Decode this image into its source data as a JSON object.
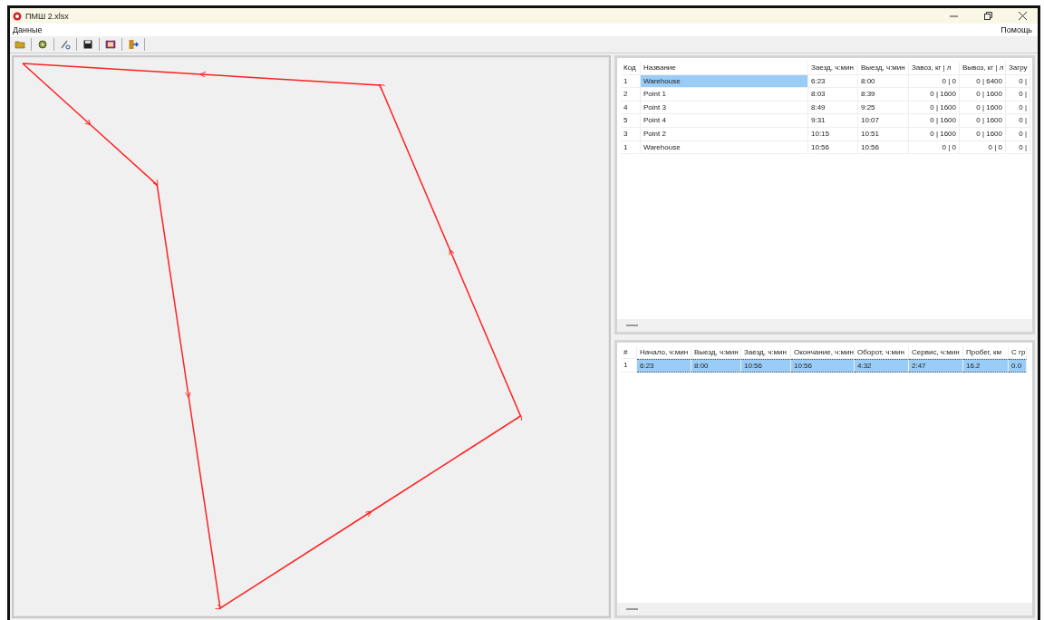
{
  "window": {
    "title": "ПМШ 2.xlsx"
  },
  "menu": {
    "left": "Данные",
    "right": "Помощь"
  },
  "stops_table": {
    "columns": [
      "Код",
      "Название",
      "Заезд, ч:мин",
      "Выезд, ч:мин",
      "Завоз, кг | л",
      "Вывоз, кг | л",
      "Загру"
    ],
    "rows": [
      {
        "selected": true,
        "cells": [
          "1",
          "Warehouse",
          "6:23",
          "8:00",
          "0 | 0",
          "0 | 6400",
          "0 |"
        ]
      },
      {
        "selected": false,
        "cells": [
          "2",
          "Point 1",
          "8:03",
          "8:39",
          "0 | 1600",
          "0 | 1600",
          "0 |"
        ]
      },
      {
        "selected": false,
        "cells": [
          "4",
          "Point 3",
          "8:49",
          "9:25",
          "0 | 1600",
          "0 | 1600",
          "0 |"
        ]
      },
      {
        "selected": false,
        "cells": [
          "5",
          "Point 4",
          "9:31",
          "10:07",
          "0 | 1600",
          "0 | 1600",
          "0 |"
        ]
      },
      {
        "selected": false,
        "cells": [
          "3",
          "Point 2",
          "10:15",
          "10:51",
          "0 | 1600",
          "0 | 1600",
          "0 |"
        ]
      },
      {
        "selected": false,
        "cells": [
          "1",
          "Warehouse",
          "10:56",
          "10:56",
          "0 | 0",
          "0 | 0",
          "0 |"
        ]
      }
    ]
  },
  "trips_table": {
    "columns": [
      "#",
      "Начало, ч:мин",
      "Выезд, ч:мин",
      "Заезд, ч:мин",
      "Окончание, ч:мин",
      "Оборот, ч:мин",
      "Сервис, ч:мин",
      "Пробег, км",
      "С гр"
    ],
    "rows": [
      {
        "selected": true,
        "cells": [
          "1",
          "6:23",
          "8:00",
          "10:56",
          "10:56",
          "4:32",
          "2:47",
          "16.2",
          "0.0"
        ]
      }
    ]
  }
}
